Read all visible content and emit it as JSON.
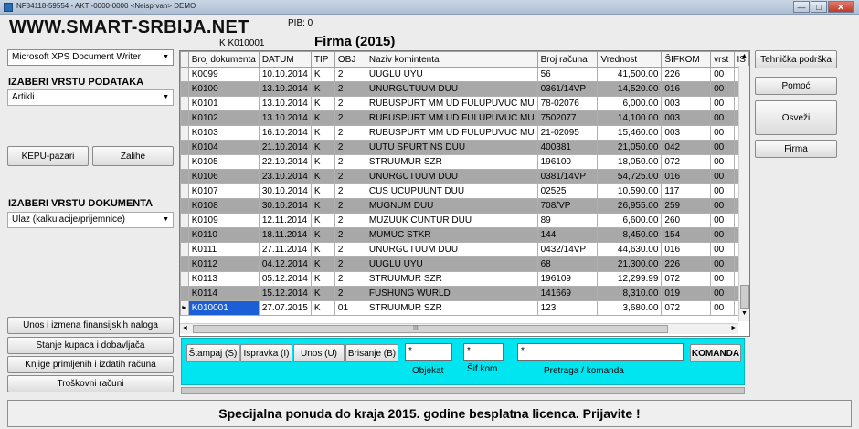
{
  "window": {
    "title": "NF84118-59554 - AKT -0000-0000 <Neisprvan> DEMO",
    "btn_min": "—",
    "btn_max": "□",
    "btn_close": "✕"
  },
  "brand": "WWW.SMART-SRBIJA.NET",
  "pib": "PIB: 0",
  "company_code": "K   K010001",
  "firma_title": "Firma (2015)",
  "left": {
    "printer": "Microsoft XPS Document Writer",
    "data_type_heading": "IZABERI VRSTU PODATAKA",
    "data_type_value": "Artikli",
    "kepu_button": "KEPU-pazari",
    "zalihe_button": "Zalihe",
    "doc_type_heading": "IZABERI  VRSTU DOKUMENTA",
    "doc_type_value": "Ulaz  (kalkulacije/prijemnice)",
    "nav_buttons": [
      "Unos i izmena finansijskih naloga",
      "Stanje kupaca i dobavljača",
      "Knjige primljenih i izdatih računa",
      "Troškovni računi"
    ]
  },
  "right_buttons": [
    "Tehnička podrška",
    "Pomoć",
    "Osveži",
    "Firma"
  ],
  "table": {
    "headers": [
      "Broj dokumenta",
      "DATUM",
      "TIP",
      "OBJ",
      "Naziv komintenta",
      "Broj računa",
      "Vrednost",
      "ŠIFKOM",
      "vrst",
      "IS"
    ],
    "rows": [
      [
        "K0099",
        "10.10.2014",
        "K",
        "2",
        "UUGLU UYU",
        "56",
        "41,500.00",
        "226",
        "00",
        ""
      ],
      [
        "K0100",
        "13.10.2014",
        "K",
        "2",
        "UNURGUTUUM DUU",
        "0361/14VP",
        "14,520.00",
        "016",
        "00",
        ""
      ],
      [
        "K0101",
        "13.10.2014",
        "K",
        "2",
        "RUBUSPURT MM UD FULUPUVUC MU",
        "78-02076",
        "6,000.00",
        "003",
        "00",
        ""
      ],
      [
        "K0102",
        "13.10.2014",
        "K",
        "2",
        "RUBUSPURT MM UD FULUPUVUC MU",
        "7502077",
        "14,100.00",
        "003",
        "00",
        ""
      ],
      [
        "K0103",
        "16.10.2014",
        "K",
        "2",
        "RUBUSPURT MM UD FULUPUVUC MU",
        "21-02095",
        "15,460.00",
        "003",
        "00",
        ""
      ],
      [
        "K0104",
        "21.10.2014",
        "K",
        "2",
        "UUTU SPURT NS DUU",
        "400381",
        "21,050.00",
        "042",
        "00",
        ""
      ],
      [
        "K0105",
        "22.10.2014",
        "K",
        "2",
        "STRUUMUR SZR",
        "196100",
        "18,050.00",
        "072",
        "00",
        ""
      ],
      [
        "K0106",
        "23.10.2014",
        "K",
        "2",
        "UNURGUTUUM DUU",
        "0381/14VP",
        "54,725.00",
        "016",
        "00",
        ""
      ],
      [
        "K0107",
        "30.10.2014",
        "K",
        "2",
        "CUS UCUPUUNT DUU",
        "02525",
        "10,590.00",
        "117",
        "00",
        ""
      ],
      [
        "K0108",
        "30.10.2014",
        "K",
        "2",
        "MUGNUM DUU",
        "708/VP",
        "26,955.00",
        "259",
        "00",
        ""
      ],
      [
        "K0109",
        "12.11.2014",
        "K",
        "2",
        "MUZUUK CUNTUR DUU",
        "89",
        "6,600.00",
        "260",
        "00",
        ""
      ],
      [
        "K0110",
        "18.11.2014",
        "K",
        "2",
        "MUMUC STKR",
        "144",
        "8,450.00",
        "154",
        "00",
        ""
      ],
      [
        "K0111",
        "27.11.2014",
        "K",
        "2",
        "UNURGUTUUM DUU",
        "0432/14VP",
        "44,630.00",
        "016",
        "00",
        ""
      ],
      [
        "K0112",
        "04.12.2014",
        "K",
        "2",
        "UUGLU UYU",
        "68",
        "21,300.00",
        "226",
        "00",
        ""
      ],
      [
        "K0113",
        "05.12.2014",
        "K",
        "2",
        "STRUUMUR SZR",
        "196109",
        "12,299.99",
        "072",
        "00",
        ""
      ],
      [
        "K0114",
        "15.12.2014",
        "K",
        "2",
        "FUSHUNG WURLD",
        "141669",
        "8,310.00",
        "019",
        "00",
        ""
      ],
      [
        "K010001",
        "27.07.2015",
        "K",
        "01",
        "STRUUMUR SZR",
        "123",
        "3,680.00",
        "072",
        "00",
        ""
      ]
    ]
  },
  "scroll": {
    "up": "▲",
    "down": "▼",
    "left": "◄",
    "right": "►",
    "grip": "III"
  },
  "command_bar": {
    "buttons": [
      "Štampaj (S)",
      "Ispravka (I)",
      "Unos (U)",
      "Brisanje (B)"
    ],
    "objekat_value": "*",
    "sifkom_value": "*",
    "pretraga_value": "*",
    "komanda_button": "KOMANDA",
    "label_objekat": "Objekat",
    "label_sifkom": "Šif.kom.",
    "label_pretraga": "Pretraga / komanda"
  },
  "footer_message": "Specijalna ponuda do kraja 2015. godine besplatna licenca. Prijavite !"
}
